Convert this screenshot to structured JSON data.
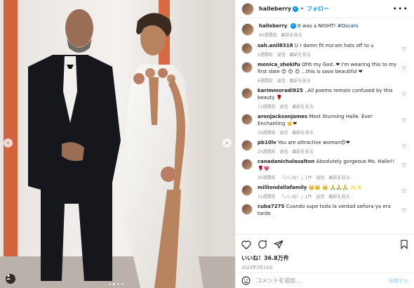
{
  "post": {
    "username": "halleberry",
    "follow_label": "フォロー",
    "more_label": "•••"
  },
  "caption": {
    "username": "halleberry",
    "text": "It was a NIGHT!",
    "hashtag": "#Oscars",
    "time": "80週間前",
    "translate": "翻訳を見る"
  },
  "comments": [
    {
      "username": "sah.anil8318",
      "text": "U r damn fit ma'am hats off to u",
      "meta": [
        "5週間前",
        "返信",
        "翻訳を見る"
      ]
    },
    {
      "username": "monica_shekifu",
      "text": "Ohh my God..❤ I'm wearing this to my first date 😍 😍 😍 ...this is sooo beautiful ❤",
      "meta": [
        "6週間前",
        "返信",
        "翻訳を見る"
      ]
    },
    {
      "username": "karimmoradi925",
      "text": "..All poems remain confused by this beauty 🌹",
      "meta": [
        "11週間前",
        "返信",
        "翻訳を見る"
      ]
    },
    {
      "username": "aronjacksonjames",
      "text": "Most Stunning Halle. Ever Enchanting 🤟❤",
      "meta": [
        "19週間前",
        "返信",
        "翻訳を見る"
      ]
    },
    {
      "username": "pb10lv",
      "text": "You are attractive woman😍❤",
      "meta": [
        "25週間前",
        "返信",
        "翻訳を見る"
      ]
    },
    {
      "username": "canadanicholasalton",
      "text": "Absolutely gorgeous Ms. Halle!! 🌹💗",
      "meta": [
        "30週間前",
        "「いいね！」1件",
        "返信",
        "翻訳を見る"
      ]
    },
    {
      "username": "milliondallafamily",
      "text": "👑👑 👑 🙏🙏🙏 ✨✨",
      "meta": [
        "31週間前",
        "「いいね！」1件",
        "返信",
        "翻訳を見る"
      ]
    },
    {
      "username": "cuba7275",
      "text": "Cuando supe toda la verdad señora ya era tarde",
      "meta": []
    }
  ],
  "footer": {
    "likes": "いいね！36.8万件",
    "date": "2023年3月14日",
    "comment_placeholder": "コメントを追加...",
    "post_label": "投稿する"
  },
  "icons": [
    "heart-icon",
    "comment-icon",
    "share-icon",
    "bookmark-icon",
    "emoji-icon",
    "user-tag-icon"
  ],
  "colors": {
    "accent": "#0095f6",
    "hashtag": "#00376b",
    "meta": "#8e8e8e"
  },
  "carousel": {
    "prev": "‹",
    "next": "›",
    "slide_count": 4,
    "active_index": 1
  }
}
